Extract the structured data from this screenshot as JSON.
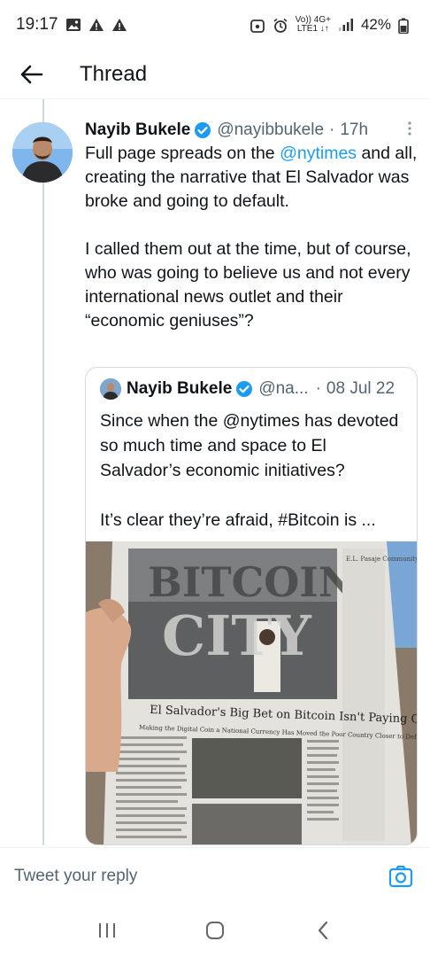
{
  "status_bar": {
    "time": "19:17",
    "network_top": "Vo)) 4G+",
    "network_bottom": "LTE1 ↓↑",
    "battery": "42%"
  },
  "header": {
    "title": "Thread"
  },
  "tweet": {
    "author_name": "Nayib Bukele",
    "handle": "@nayibbukele",
    "separator": "·",
    "time": "17h",
    "text_before_mention": "Full page spreads on the ",
    "mention": "@nytimes",
    "text_after_mention": " and all, creating the narrative that El Salvador was broke and going to default.",
    "paragraph_2": "I called them out at the time, but of course, who was going to believe us and not every international news outlet and their “economic geniuses”?"
  },
  "quote": {
    "author_name": "Nayib Bukele",
    "handle": "@na...",
    "separator": "·",
    "date": "08 Jul 22",
    "paragraph_1": "Since when the @nytimes has devoted so much time and space to El Salvador’s economic initiatives?",
    "paragraph_2": "It’s clear they’re afraid, #Bitcoin is ...",
    "image": {
      "headline_big_1": "BITCOIN",
      "headline_big_2": "CITY",
      "headline": "El Salvador's Big Bet on Bitcoin Isn't Paying Off",
      "subhead": "Making the Digital Coin a National Currency Has Moved the Poor Country Closer to Default",
      "sidebar_text": "E.L. Pasaje Community Of Cafting Green Energy"
    }
  },
  "reply_bar": {
    "placeholder": "Tweet your reply"
  },
  "colors": {
    "accent": "#1d9bf0",
    "text": "#0f1419",
    "secondary": "#536471",
    "border": "#cfd9de"
  }
}
